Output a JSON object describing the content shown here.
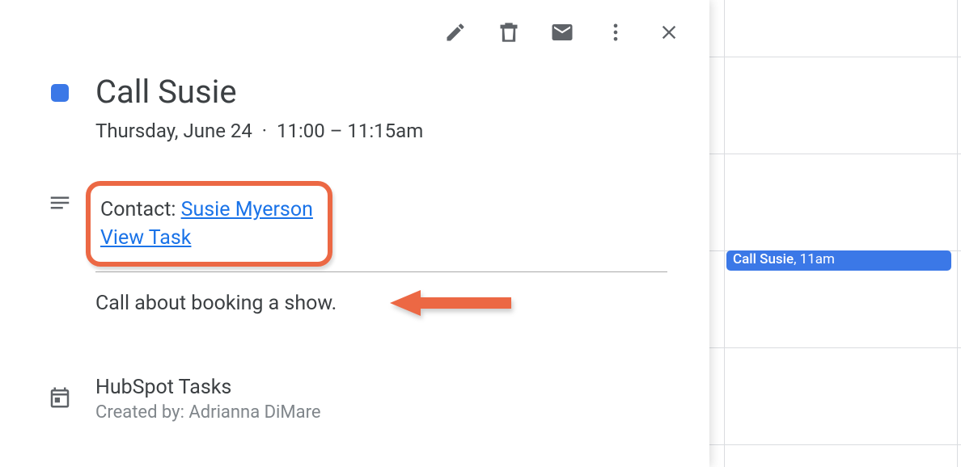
{
  "event": {
    "title": "Call Susie",
    "date": "Thursday, June 24",
    "time": "11:00 – 11:15am",
    "contact_label": "Contact: ",
    "contact_name": "Susie Myerson",
    "view_task_label": "View Task",
    "note_body": "Call about booking a show.",
    "calendar_name": "HubSpot Tasks",
    "created_by_label": "Created by: Adrianna DiMare"
  },
  "grid": {
    "event_title": "Call Susie",
    "event_time": "11am"
  }
}
